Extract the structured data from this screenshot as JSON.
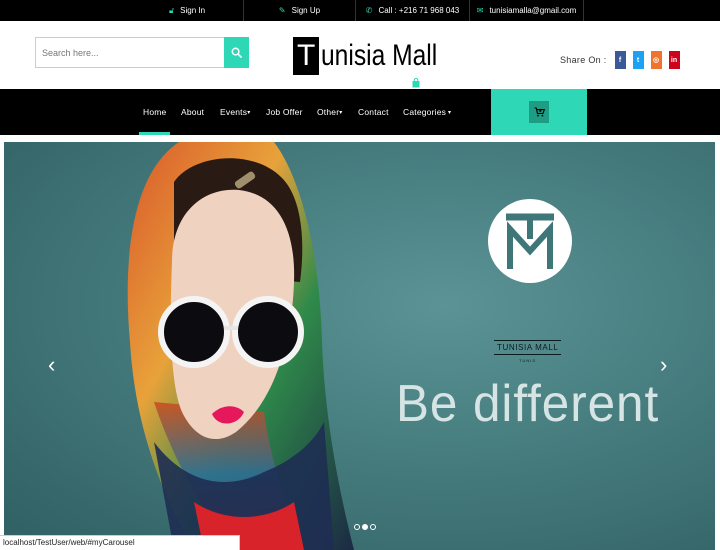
{
  "topbar": {
    "signin": "Sign In",
    "signup": "Sign Up",
    "call": "Call : +216 71 968 043",
    "email": "tunisiamalla@gmail.com"
  },
  "header": {
    "search_placeholder": "Search here...",
    "logo_letter": "T",
    "logo_rest": "unisia Mall",
    "share_label": "Share On :",
    "social": [
      {
        "name": "facebook",
        "glyph": "f",
        "color": "#3b5998"
      },
      {
        "name": "twitter",
        "glyph": "t",
        "color": "#1da1f2"
      },
      {
        "name": "instagram",
        "glyph": "◎",
        "color": "#f0722c"
      },
      {
        "name": "linkedin",
        "glyph": "in",
        "color": "#d0021b"
      }
    ]
  },
  "nav": {
    "items": [
      {
        "label": "Home",
        "active": true
      },
      {
        "label": "About"
      },
      {
        "label": "Events",
        "caret": "▾"
      },
      {
        "label": "Job Offer"
      },
      {
        "label": "Other",
        "caret": "▾"
      },
      {
        "label": "Contact"
      },
      {
        "label": "Categories",
        "caret": " ▾"
      }
    ]
  },
  "carousel": {
    "brand_name": "TUNISIA MALL",
    "brand_city": "TUNIS",
    "tagline": "Be different",
    "slides": 3,
    "active_slide": 2
  },
  "status_bar": {
    "url": "localhost/TestUser/web/#myCarousel"
  },
  "colors": {
    "accent": "#2ed8b6",
    "dark": "#000000"
  }
}
